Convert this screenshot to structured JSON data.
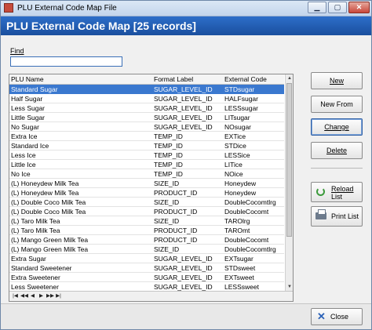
{
  "window": {
    "title": "PLU External Code Map File"
  },
  "header": {
    "title": "PLU External Code Map [25 records]"
  },
  "find": {
    "label": "Find",
    "value": ""
  },
  "grid": {
    "columns": [
      "PLU Name",
      "Format Label",
      "External Code"
    ],
    "rows": [
      [
        "Standard Sugar",
        "SUGAR_LEVEL_ID",
        "STDsugar"
      ],
      [
        "Half Sugar",
        "SUGAR_LEVEL_ID",
        "HALFsugar"
      ],
      [
        "Less Sugar",
        "SUGAR_LEVEL_ID",
        "LESSsugar"
      ],
      [
        "Little Sugar",
        "SUGAR_LEVEL_ID",
        "LITsugar"
      ],
      [
        "No Sugar",
        "SUGAR_LEVEL_ID",
        "NOsugar"
      ],
      [
        "Extra Ice",
        "TEMP_ID",
        "EXTice"
      ],
      [
        "Standard Ice",
        "TEMP_ID",
        "STDice"
      ],
      [
        "Less Ice",
        "TEMP_ID",
        "LESSice"
      ],
      [
        "Little Ice",
        "TEMP_ID",
        "LITice"
      ],
      [
        "No Ice",
        "TEMP_ID",
        "NOice"
      ],
      [
        "(L) Honeydew Milk Tea",
        "SIZE_ID",
        "Honeydew"
      ],
      [
        "(L) Honeydew Milk Tea",
        "PRODUCT_ID",
        "Honeydew"
      ],
      [
        "(L) Double Coco Milk Tea",
        "SIZE_ID",
        "DoubleCocomtlrg"
      ],
      [
        "(L) Double Coco Milk Tea",
        "PRODUCT_ID",
        "DoubleCocomt"
      ],
      [
        "(L) Taro Milk Tea",
        "SIZE_ID",
        "TAROlrg"
      ],
      [
        "(L) Taro Milk Tea",
        "PRODUCT_ID",
        "TAROmt"
      ],
      [
        "(L) Mango Green Milk Tea",
        "PRODUCT_ID",
        "DoubleCocomt"
      ],
      [
        "(L) Mango Green Milk Tea",
        "SIZE_ID",
        "DoubleCocomtlrg"
      ],
      [
        "Extra Sugar",
        "SUGAR_LEVEL_ID",
        "EXTsugar"
      ],
      [
        "Standard Sweetener",
        "SUGAR_LEVEL_ID",
        "STDsweet"
      ],
      [
        "Extra Sweetener",
        "SUGAR_LEVEL_ID",
        "EXTsweet"
      ],
      [
        "Less Sweetener",
        "SUGAR_LEVEL_ID",
        "LESSsweet"
      ]
    ],
    "selected_row": 0,
    "nav_buttons": [
      "|◀",
      "◀◀",
      "◀",
      "▶",
      "▶▶",
      "▶|"
    ]
  },
  "buttons": {
    "new": "New",
    "new_from": "New From",
    "change": "Change",
    "delete": "Delete",
    "reload_line1": "Reload",
    "reload_line2": "List",
    "print": "Print List",
    "close": "Close"
  },
  "colors": {
    "header_band": "#2d6ec9",
    "selection": "#3a78cf"
  }
}
